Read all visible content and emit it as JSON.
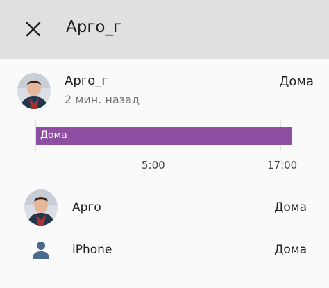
{
  "appbar": {
    "title": "Арго_г",
    "close_icon": "close-icon",
    "background": "#e0e0e0"
  },
  "main": {
    "name": "Арго_г",
    "time": "2 мин. назад",
    "status": "Дома"
  },
  "timeline": {
    "segment_label": "Дома",
    "bar_color": "#8e4fa2",
    "ticks": [
      "5:00",
      "17:00"
    ]
  },
  "members": [
    {
      "name": "Арго",
      "status": "Дома",
      "icon": "avatar-photo"
    },
    {
      "name": "iPhone",
      "status": "Дома",
      "icon": "person-icon",
      "icon_color": "#4b6a8c"
    }
  ]
}
